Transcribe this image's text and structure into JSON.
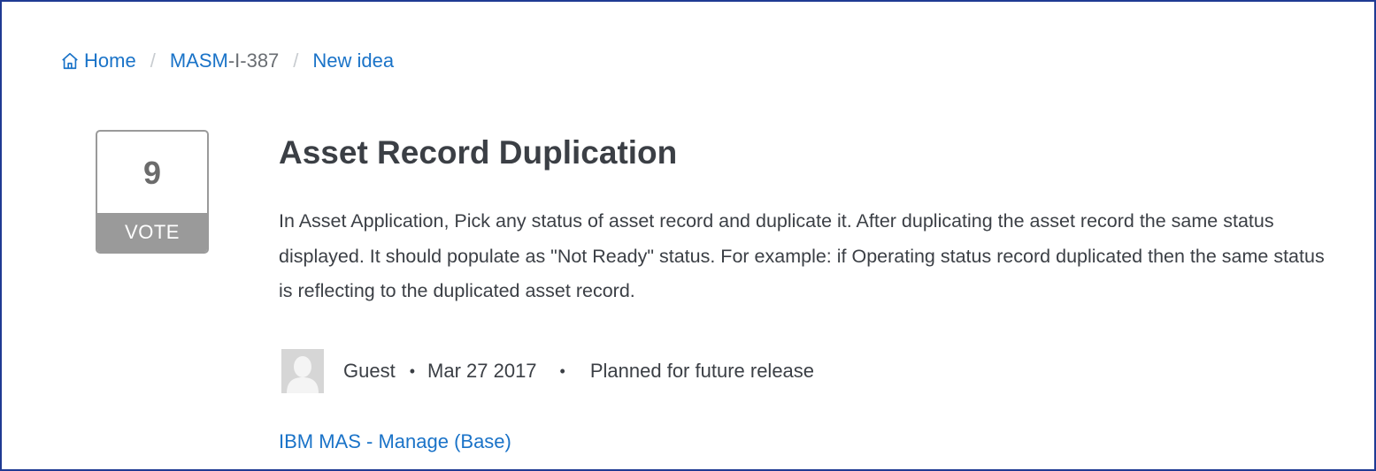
{
  "breadcrumb": {
    "home": "Home",
    "idea_id_prefix": "MASM",
    "idea_id_suffix": "-I-387",
    "current": "New idea",
    "separator": "/"
  },
  "vote": {
    "count": "9",
    "label": "VOTE"
  },
  "idea": {
    "title": "Asset Record Duplication",
    "description": "In Asset Application, Pick any status of asset record and duplicate it. After duplicating the asset record the same status displayed. It should populate as \"Not Ready\" status. For example: if Operating status record duplicated then the same status is reflecting to the duplicated asset record."
  },
  "meta": {
    "author": "Guest",
    "date": "Mar 27 2017",
    "status": "Planned for future release",
    "bullet": "•"
  },
  "category": "IBM MAS - Manage (Base)",
  "icons": {
    "home": "home-icon",
    "avatar": "user-avatar-placeholder"
  },
  "colors": {
    "link": "#1a73c8",
    "vote_gray": "#9a9a9a",
    "text": "#3b3f45",
    "frame_border": "#1f3a93"
  }
}
